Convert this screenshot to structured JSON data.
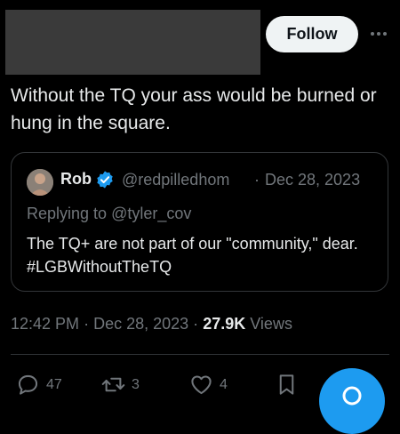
{
  "header": {
    "follow_label": "Follow",
    "more_icon": "more-horizontal-icon"
  },
  "tweet": {
    "text": "Without the TQ your ass would be burned or hung in the square."
  },
  "quote": {
    "name": "Rob",
    "verified_icon": "verified-badge-icon",
    "handle": "@redpilledhom",
    "separator": "·",
    "date": "Dec 28, 2023",
    "replying_prefix": "Replying to ",
    "replying_handle": "@tyler_cov",
    "text": "The TQ+ are not part of our \"community,\" dear. #LGBWithoutTheTQ"
  },
  "meta": {
    "time": "12:42 PM",
    "separator": "·",
    "date": "Dec 28, 2023",
    "views_count": "27.9K",
    "views_label": "Views"
  },
  "actions": {
    "replies": "47",
    "reposts": "3",
    "likes": "4"
  },
  "colors": {
    "background": "#000000",
    "text": "#e7e9ea",
    "muted": "#71767b",
    "accent": "#1d9bf0"
  }
}
